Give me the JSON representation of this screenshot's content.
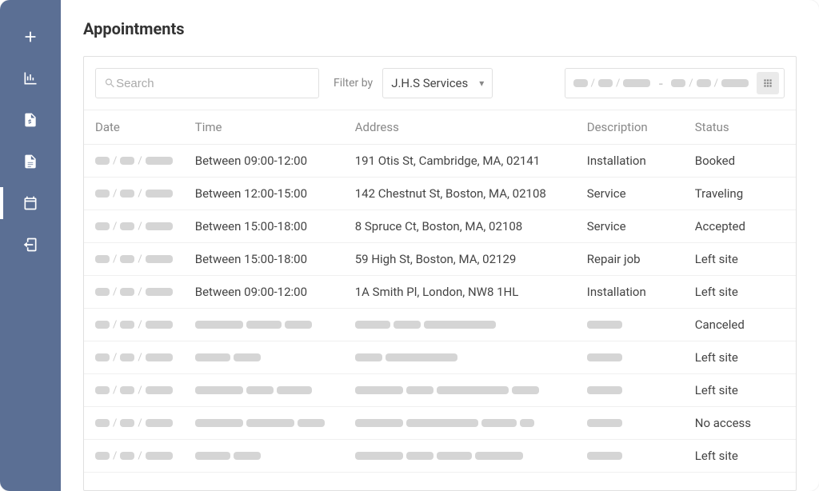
{
  "page": {
    "title": "Appointments"
  },
  "toolbar": {
    "search_placeholder": "Search",
    "filter_label": "Filter by",
    "filter_value": "J.H.S Services"
  },
  "table": {
    "headers": {
      "date": "Date",
      "time": "Time",
      "address": "Address",
      "description": "Description",
      "status": "Status"
    },
    "rows": [
      {
        "date": null,
        "time": "Between 09:00-12:00",
        "address": "191 Otis St, Cambridge, MA, 02141",
        "description": "Installation",
        "status": "Booked"
      },
      {
        "date": null,
        "time": "Between 12:00-15:00",
        "address": "142 Chestnut St, Boston, MA, 02108",
        "description": "Service",
        "status": "Traveling"
      },
      {
        "date": null,
        "time": "Between 15:00-18:00",
        "address": "8 Spruce Ct, Boston, MA, 02108",
        "description": "Service",
        "status": "Accepted"
      },
      {
        "date": null,
        "time": "Between 15:00-18:00",
        "address": "59 High St, Boston, MA, 02129",
        "description": "Repair job",
        "status": "Left site"
      },
      {
        "date": null,
        "time": "Between 09:00-12:00",
        "address": "1A Smith Pl, London, NW8 1HL",
        "description": "Installation",
        "status": "Left site"
      },
      {
        "date": null,
        "time": null,
        "address": null,
        "description": null,
        "status": "Canceled"
      },
      {
        "date": null,
        "time": null,
        "address": null,
        "description": null,
        "status": "Left site"
      },
      {
        "date": null,
        "time": null,
        "address": null,
        "description": null,
        "status": "Left site"
      },
      {
        "date": null,
        "time": null,
        "address": null,
        "description": null,
        "status": "No access"
      },
      {
        "date": null,
        "time": null,
        "address": null,
        "description": null,
        "status": "Left site"
      }
    ]
  }
}
